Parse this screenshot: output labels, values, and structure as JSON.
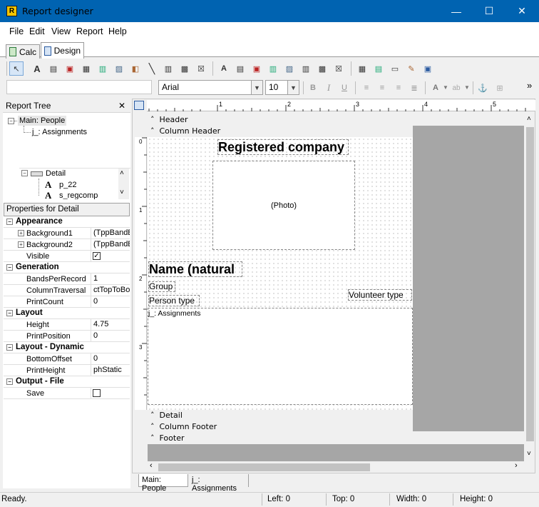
{
  "window": {
    "title": "Report designer",
    "minimize": "—",
    "maximize": "☐",
    "close": "✕",
    "app_icon_letter": "R"
  },
  "menu": {
    "items": [
      "File",
      "Edit",
      "View",
      "Report",
      "Help"
    ]
  },
  "tabs": [
    {
      "label": "Calc",
      "active": false
    },
    {
      "label": "Design",
      "active": true
    }
  ],
  "toolbar": {
    "font_name": "Arial",
    "font_size": "10",
    "bold": "B",
    "italic": "I",
    "underline": "U",
    "overflow": "»"
  },
  "report_tree": {
    "title": "Report Tree",
    "close": "✕",
    "nodes": [
      {
        "label": "Main: People"
      },
      {
        "label": "j_: Assignments"
      }
    ],
    "band_nodes": [
      {
        "label": "Detail"
      },
      {
        "label": "p_22"
      },
      {
        "label": "s_regcomp"
      }
    ]
  },
  "properties": {
    "header": "Properties for Detail",
    "categories": [
      {
        "name": "Appearance",
        "rows": [
          {
            "name": "Background1",
            "value": "(TppBandBa",
            "expandable": true
          },
          {
            "name": "Background2",
            "value": "(TppBandBa",
            "expandable": true
          },
          {
            "name": "Visible",
            "value": "",
            "checkbox": true,
            "checked": true
          }
        ]
      },
      {
        "name": "Generation",
        "rows": [
          {
            "name": "BandsPerRecord",
            "value": "1"
          },
          {
            "name": "ColumnTraversal",
            "value": "ctTopToBot"
          },
          {
            "name": "PrintCount",
            "value": "0"
          }
        ]
      },
      {
        "name": "Layout",
        "rows": [
          {
            "name": "Height",
            "value": "4.75"
          },
          {
            "name": "PrintPosition",
            "value": "0"
          }
        ]
      },
      {
        "name": "Layout - Dynamic",
        "rows": [
          {
            "name": "BottomOffset",
            "value": "0"
          },
          {
            "name": "PrintHeight",
            "value": "phStatic"
          }
        ]
      },
      {
        "name": "Output - File",
        "rows": [
          {
            "name": "Save",
            "value": "",
            "checkbox": true,
            "checked": false
          }
        ]
      }
    ]
  },
  "ruler": {
    "h_ticks": [
      "1",
      "2",
      "3",
      "4",
      "5"
    ],
    "v_ticks": [
      "0",
      "1",
      "2",
      "3"
    ]
  },
  "bands": {
    "header": "Header",
    "column_header": "Column Header",
    "detail": "Detail",
    "column_footer": "Column Footer",
    "footer": "Footer"
  },
  "design": {
    "registered_company": "Registered company",
    "photo": "(Photo)",
    "name_natural": "Name (natural",
    "group": "Group",
    "person_type": "Person type",
    "volunteer_type": "Volunteer type",
    "subreport": "j_: Assignments"
  },
  "bottom_tabs": [
    "Main: People",
    "j_: Assignments"
  ],
  "status": {
    "message": "Ready.",
    "left": "Left: 0",
    "top": "Top: 0",
    "width": "Width: 0",
    "height": "Height: 0"
  }
}
